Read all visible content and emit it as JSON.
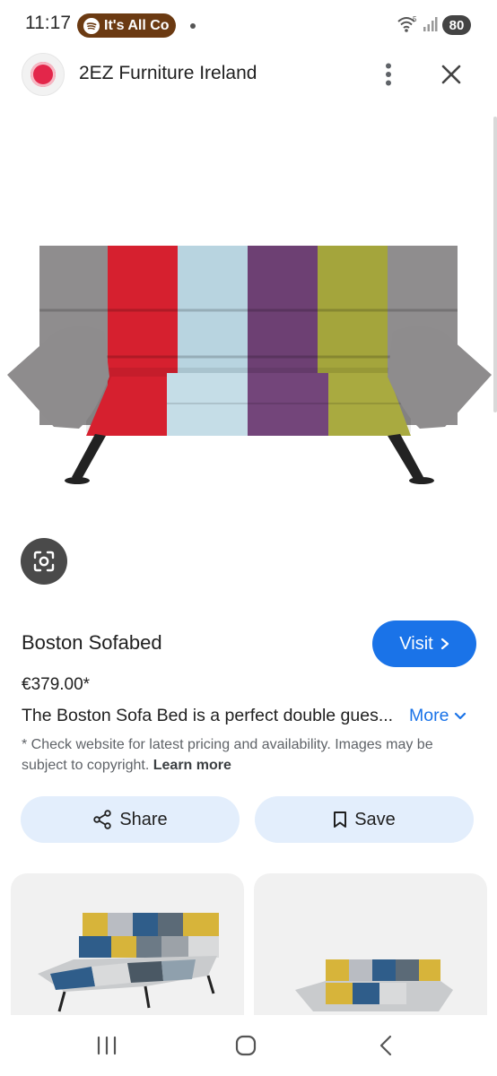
{
  "status_bar": {
    "time": "11:17",
    "media_pill": "It's All Co",
    "battery": "80",
    "wifi_badge": "5"
  },
  "header": {
    "site_name": "2EZ Furniture Ireland"
  },
  "product": {
    "title": "Boston Sofabed",
    "visit_label": "Visit",
    "price": "€379.00*",
    "description": "The Boston Sofa Bed is a perfect double gues...",
    "more_label": "More",
    "disclaimer": "* Check website for latest pricing and availability. Images may be subject to copyright.",
    "learn_more": "Learn more"
  },
  "actions": {
    "share_label": "Share",
    "save_label": "Save"
  },
  "colors": {
    "accent": "#1a73e8",
    "action_bg": "#e3eefc",
    "sofa_segments": [
      "#8e8c8d",
      "#d41f2f",
      "#b6d3df",
      "#6c3f72",
      "#a2a33b",
      "#8e8c8d"
    ]
  },
  "icons": {
    "lens": "google-lens-icon",
    "menu": "more-vert-icon",
    "close": "close-icon",
    "share": "share-icon",
    "save": "bookmark-icon"
  }
}
